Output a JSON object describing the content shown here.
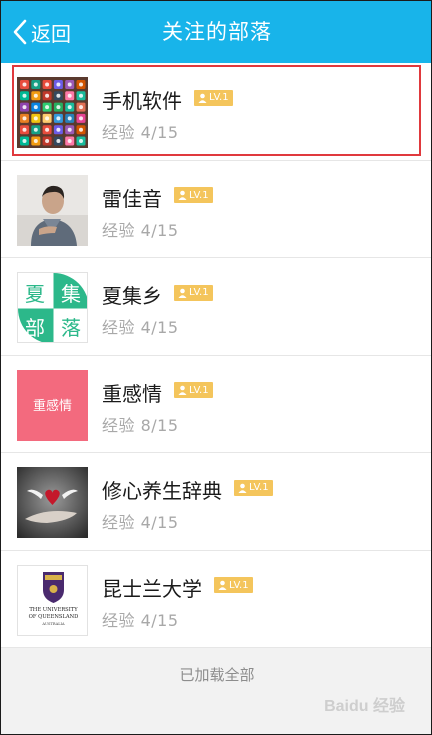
{
  "header": {
    "back_label": "返回",
    "title": "关注的部落"
  },
  "badge_label": "LV.1",
  "items": [
    {
      "name": "手机软件",
      "experience": "经验 4/15",
      "thumb": "app-icon-grid"
    },
    {
      "name": "雷佳音",
      "experience": "经验 4/15",
      "thumb": "portrait-photo"
    },
    {
      "name": "夏集乡",
      "experience": "经验 4/15",
      "thumb_text": [
        "夏",
        "集",
        "部",
        "落"
      ]
    },
    {
      "name": "重感情",
      "experience": "经验 8/15",
      "thumb_text_single": "重感情"
    },
    {
      "name": "修心养生辞典",
      "experience": "经验 4/15",
      "thumb": "hands-heart-photo"
    },
    {
      "name": "昆士兰大学",
      "experience": "经验 4/15",
      "thumb": "university-crest",
      "crest_lines": [
        "THE UNIVERSITY",
        "OF QUEENSLAND",
        "AUSTRALIA"
      ]
    }
  ],
  "footer": {
    "label": "已加载全部"
  },
  "watermark": "Baidu 经验",
  "colors": {
    "header_bg": "#18b4ea",
    "badge_bg": "#f4c55c",
    "highlight_border": "#e0393d",
    "thumb_pink": "#f36a7e",
    "thumb_green": "#2cb88a"
  }
}
